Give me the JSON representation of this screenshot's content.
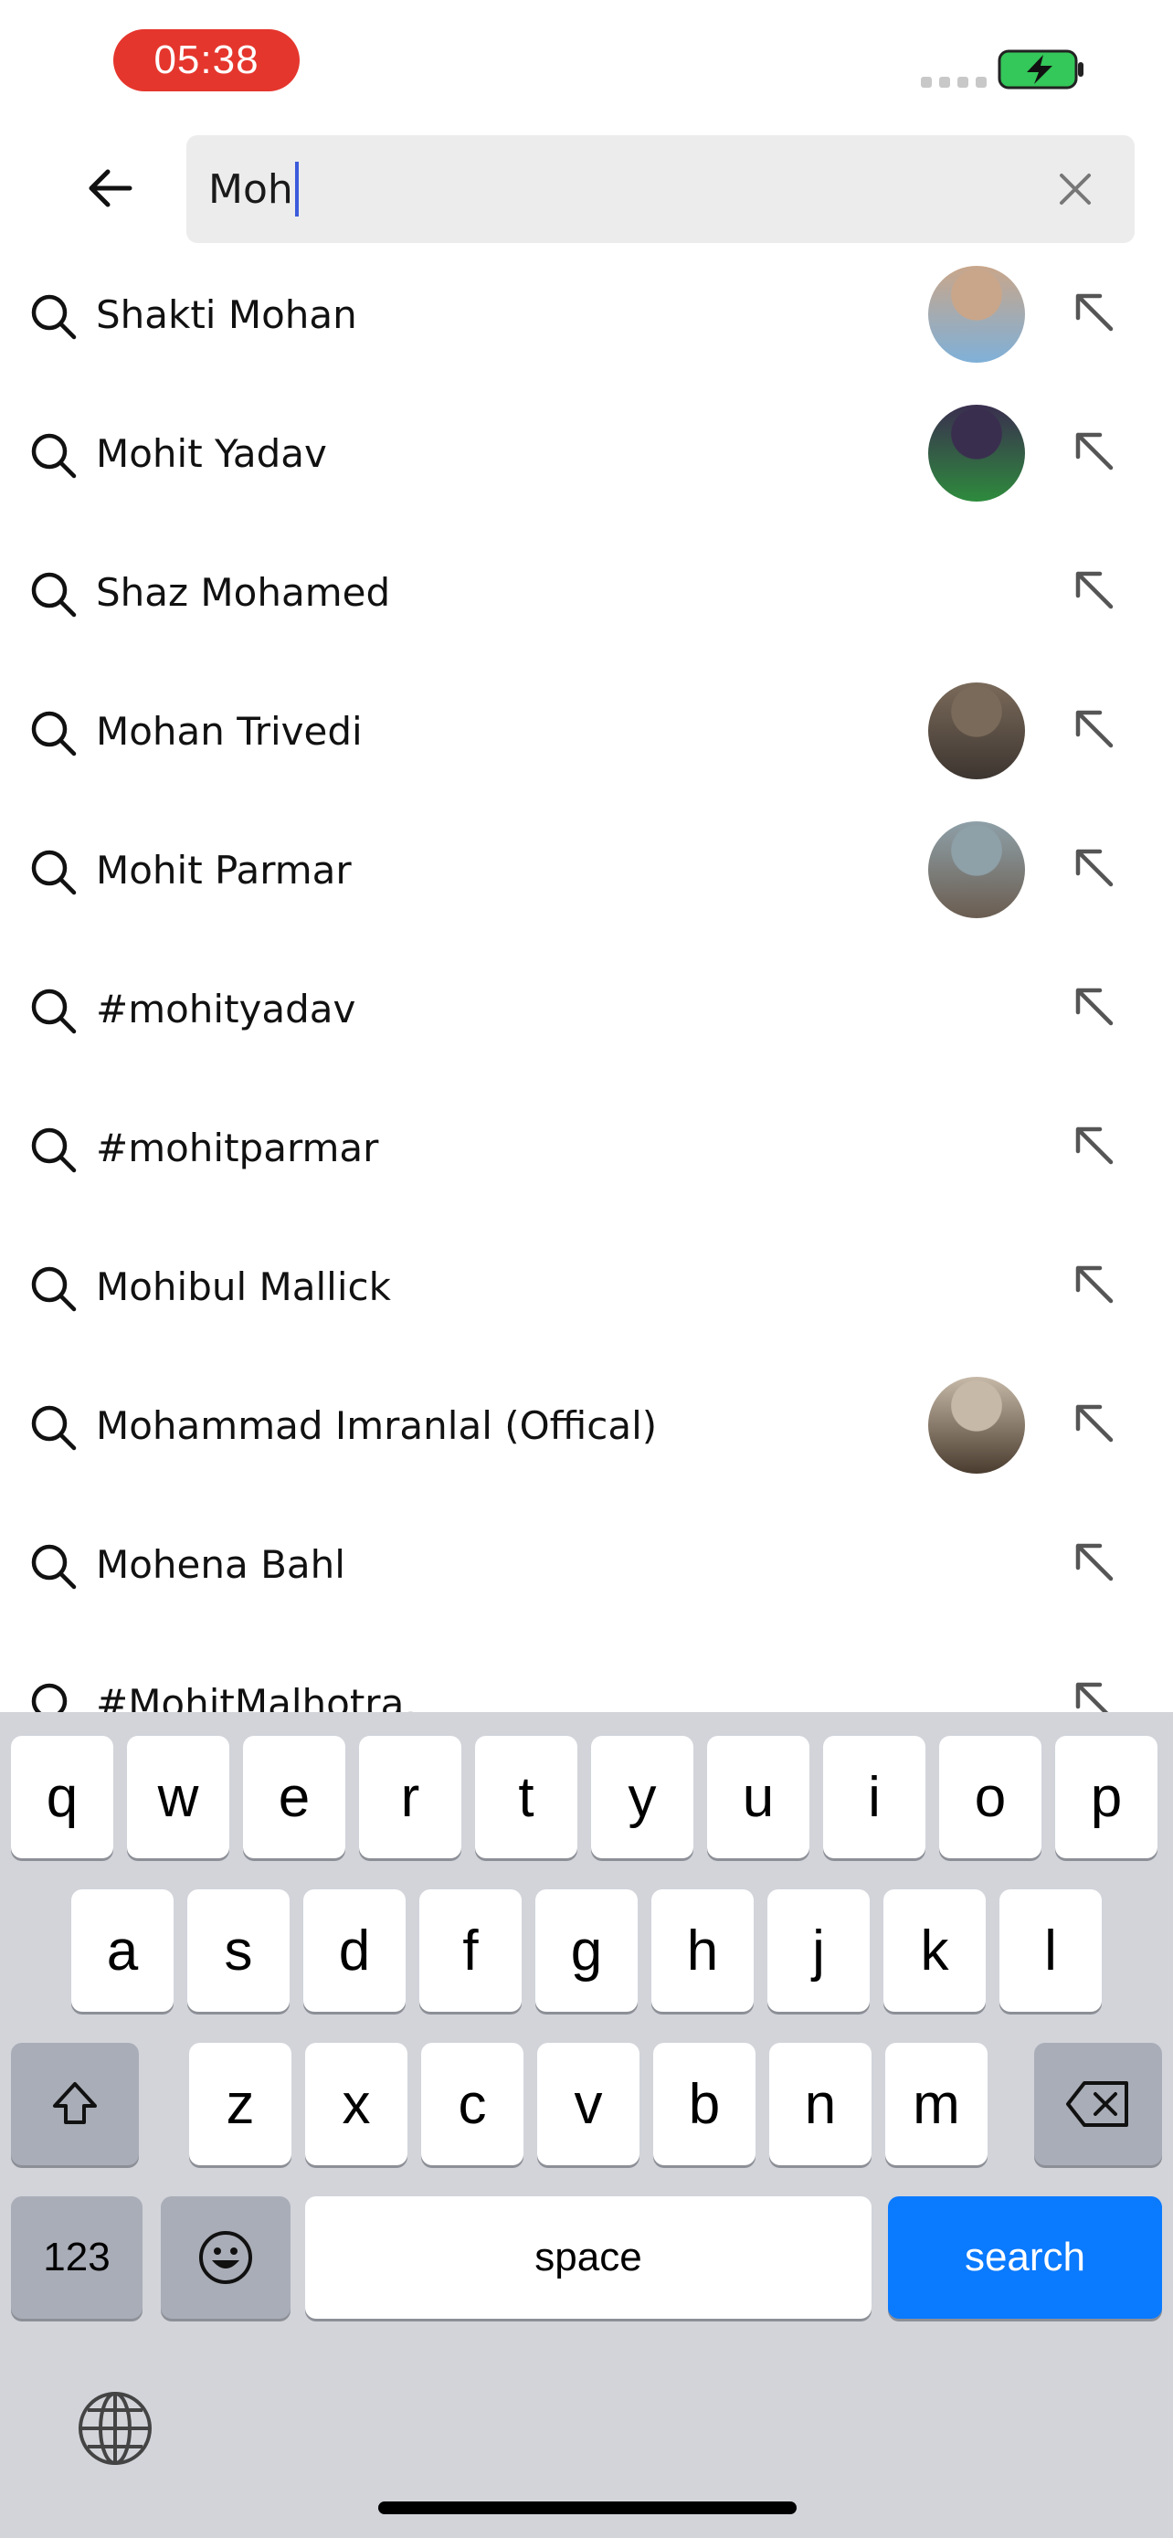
{
  "status_bar": {
    "time": "05:38"
  },
  "search": {
    "query": "Moh"
  },
  "results": [
    {
      "label": "Shakti Mohan",
      "avatar": true,
      "avatar_colors": [
        "#c9a68a",
        "#7fb0d8"
      ]
    },
    {
      "label": "Mohit Yadav",
      "avatar": true,
      "avatar_colors": [
        "#3a2e4f",
        "#2e8b3d"
      ]
    },
    {
      "label": "Shaz Mohamed",
      "avatar": false
    },
    {
      "label": "Mohan Trivedi",
      "avatar": true,
      "avatar_colors": [
        "#7a6a5a",
        "#3d3530"
      ]
    },
    {
      "label": "Mohit Parmar",
      "avatar": true,
      "avatar_colors": [
        "#8ea0a8",
        "#6b5d50"
      ]
    },
    {
      "label": "#mohityadav",
      "avatar": false
    },
    {
      "label": "#mohitparmar",
      "avatar": false
    },
    {
      "label": "Mohibul Mallick",
      "avatar": false
    },
    {
      "label": "Mohammad Imranlal (Offical)",
      "avatar": true,
      "avatar_colors": [
        "#c7b9a8",
        "#4a3c2e"
      ]
    },
    {
      "label": "Mohena Bahl",
      "avatar": false
    },
    {
      "label": "#MohitMalhotra,",
      "avatar": false
    }
  ],
  "keyboard": {
    "row1": [
      "q",
      "w",
      "e",
      "r",
      "t",
      "y",
      "u",
      "i",
      "o",
      "p"
    ],
    "row2": [
      "a",
      "s",
      "d",
      "f",
      "g",
      "h",
      "j",
      "k",
      "l"
    ],
    "row3": [
      "z",
      "x",
      "c",
      "v",
      "b",
      "n",
      "m"
    ],
    "numbers_label": "123",
    "space_label": "space",
    "search_label": "search"
  },
  "colors": {
    "time_pill": "#e5362d",
    "caret": "#3b5bdb",
    "search_key": "#0a7aff",
    "battery": "#34c759"
  }
}
